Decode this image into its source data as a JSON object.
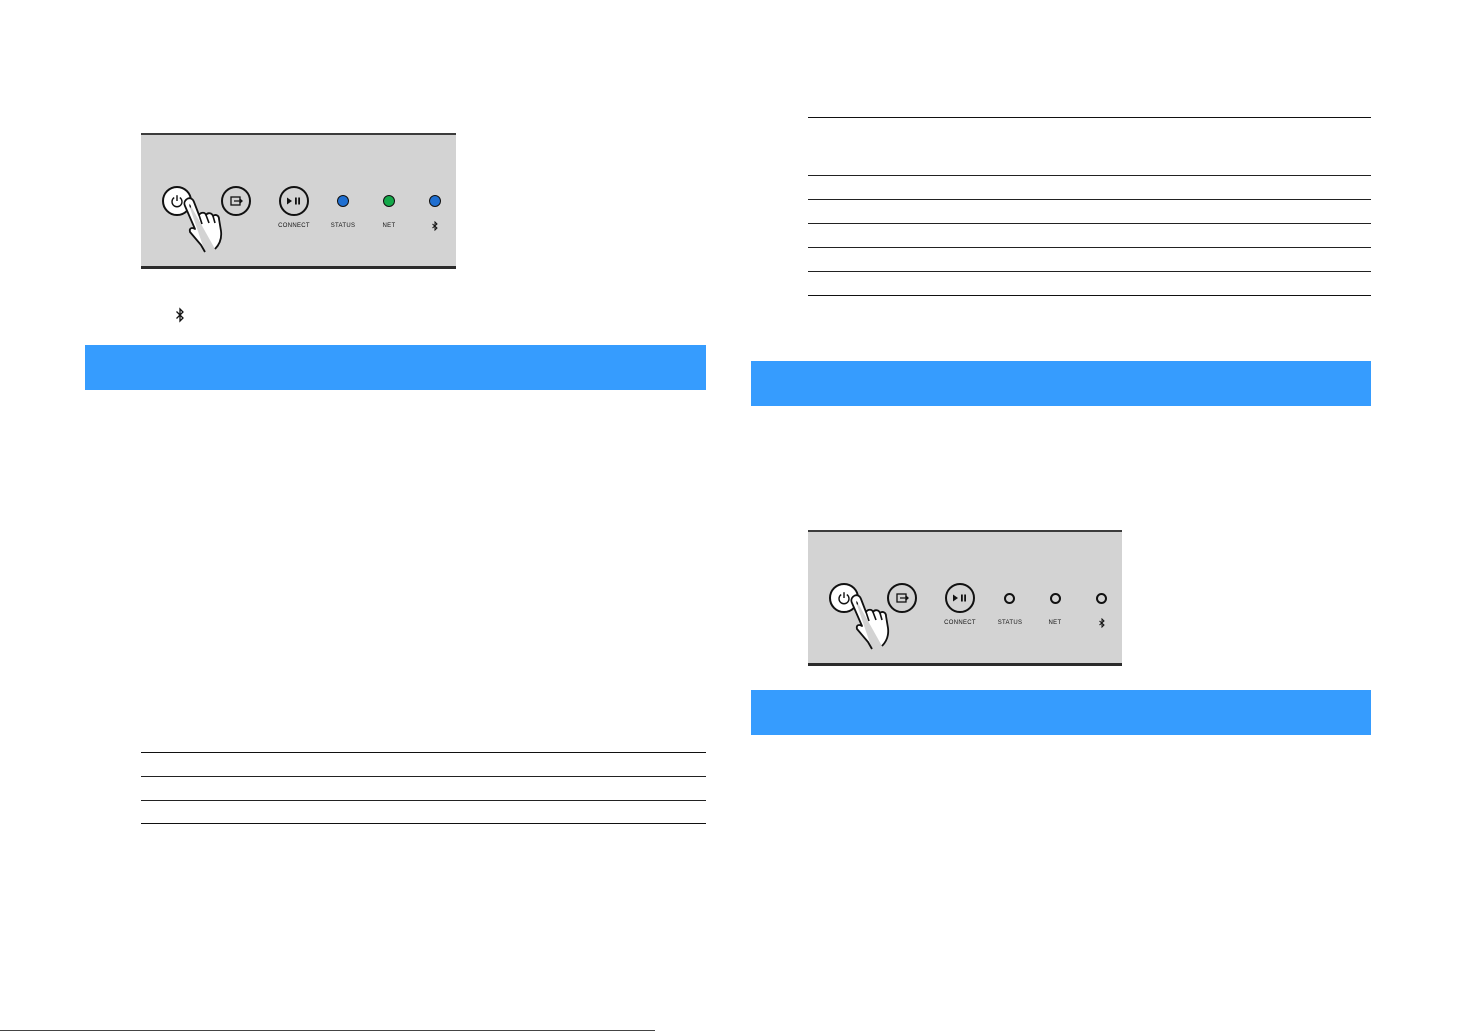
{
  "colors": {
    "section_bar": "#369cfe",
    "panel_bg": "#d3d3d3",
    "led_status_on": "#1f6fd1",
    "led_net_on": "#14a84a",
    "led_bt_on": "#1f6fd1"
  },
  "panel_top": {
    "buttons": [
      {
        "icon": "power-icon",
        "pressed": true
      },
      {
        "icon": "input-icon"
      },
      {
        "icon": "play-pause-icon"
      }
    ],
    "labels": {
      "connect": "CONNECT",
      "status": "STATUS",
      "net": "NET",
      "bluetooth": "bluetooth-icon"
    },
    "leds": {
      "status": "on",
      "net": "on",
      "bluetooth": "on"
    }
  },
  "bluetooth_note_icon": "bluetooth-icon",
  "panel_bottom": {
    "buttons": [
      {
        "icon": "power-icon",
        "pressed": true
      },
      {
        "icon": "input-icon"
      },
      {
        "icon": "play-pause-icon"
      }
    ],
    "labels": {
      "connect": "CONNECT",
      "status": "STATUS",
      "net": "NET",
      "bluetooth": "bluetooth-icon"
    },
    "leds": {
      "status": "off",
      "net": "off",
      "bluetooth": "off"
    }
  }
}
